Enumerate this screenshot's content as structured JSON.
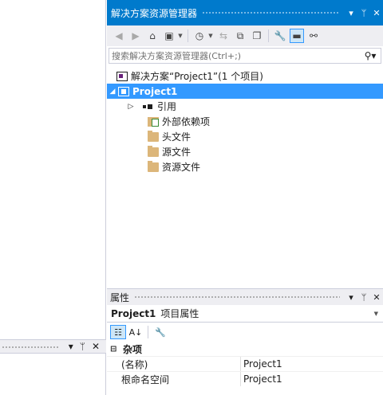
{
  "solution_explorer": {
    "title": "解决方案资源管理器",
    "search_placeholder": "搜索解决方案资源管理器(Ctrl+;)",
    "tree": {
      "solution": "解决方案“Project1”(1 个项目)",
      "project": "Project1",
      "items": [
        "引用",
        "外部依赖项",
        "头文件",
        "源文件",
        "资源文件"
      ]
    }
  },
  "properties": {
    "title": "属性",
    "object_name": "Project1",
    "object_type": "项目属性",
    "category": "杂项",
    "rows": [
      {
        "key": "(名称)",
        "value": "Project1"
      },
      {
        "key": "根命名空间",
        "value": "Project1"
      }
    ]
  },
  "window_buttons": {
    "dropdown": "▾",
    "pin": "📌",
    "close": "✕"
  },
  "colors": {
    "accent": "#007acc",
    "selection": "#3399ff",
    "panel": "#eeeef2"
  }
}
